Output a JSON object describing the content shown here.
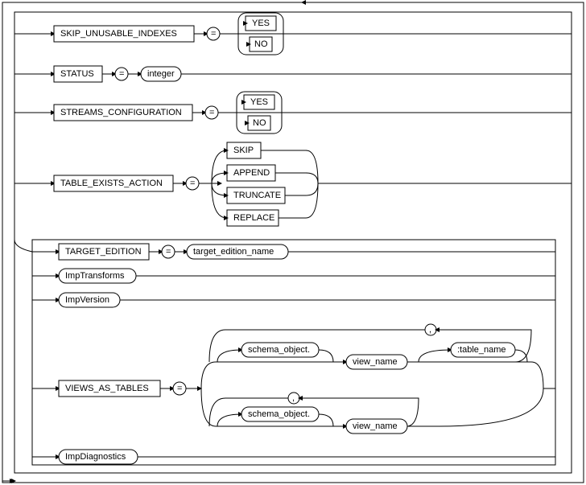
{
  "params": {
    "skip_unusable_indexes": "SKIP_UNUSABLE_INDEXES",
    "status": "STATUS",
    "streams_configuration": "STREAMS_CONFIGURATION",
    "table_exists_action": "TABLE_EXISTS_ACTION",
    "target_edition": "TARGET_EDITION",
    "imp_transforms": "ImpTransforms",
    "imp_version": "ImpVersion",
    "views_as_tables": "VIEWS_AS_TABLES",
    "imp_diagnostics": "ImpDiagnostics"
  },
  "tokens": {
    "eq": "=",
    "yes": "YES",
    "no": "NO",
    "integer": "integer",
    "skip": "SKIP",
    "append": "APPEND",
    "truncate": "TRUNCATE",
    "replace": "REPLACE",
    "target_edition_name": "target_edition_name",
    "schema_object": "schema_object.",
    "view_name": "view_name",
    "table_name": ":table_name",
    "comma": ","
  }
}
